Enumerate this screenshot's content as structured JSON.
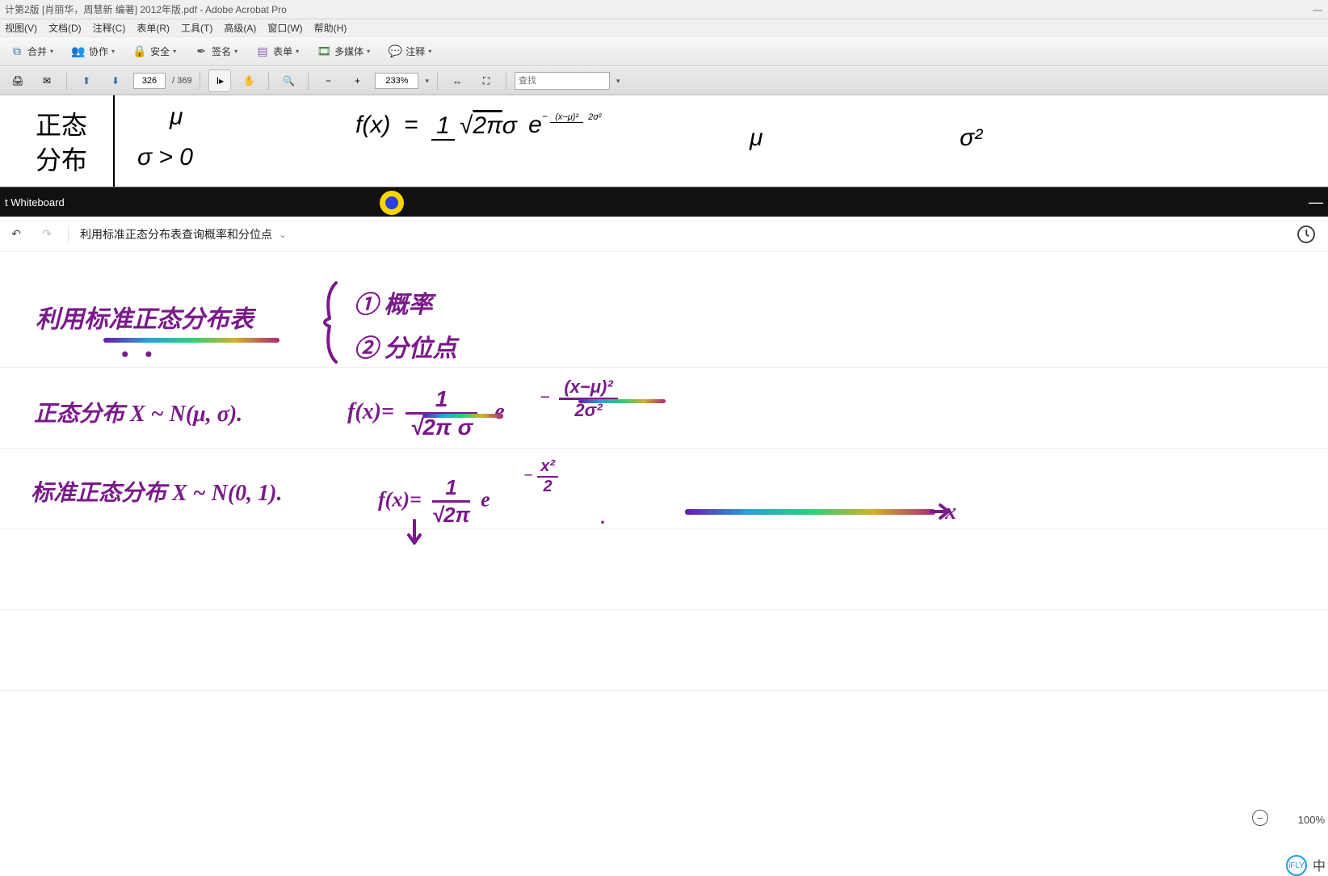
{
  "acrobat": {
    "title": "计第2版 [肖丽华，周慧新 编著] 2012年版.pdf - Adobe Acrobat Pro",
    "menu": {
      "view": "视图(V)",
      "doc": "文档(D)",
      "annot": "注释(C)",
      "forms": "表单(R)",
      "tools": "工具(T)",
      "adv": "高级(A)",
      "window": "窗口(W)",
      "help": "帮助(H)"
    },
    "toolbar1": {
      "merge": "合并",
      "collab": "协作",
      "secure": "安全",
      "sign": "签名",
      "form": "表单",
      "media": "多媒体",
      "comment": "注释"
    },
    "toolbar2": {
      "page": "326",
      "total": "/ 369",
      "zoom": "233%",
      "search_placeholder": "查找"
    }
  },
  "pdf": {
    "row_label_1": "正态",
    "row_label_2": "分布",
    "mu": "μ",
    "sigma_cond": "σ > 0",
    "fx_html": "f(x) = ",
    "col_mu": "μ",
    "col_sigma2": "σ²"
  },
  "whiteboard": {
    "app": "t Whiteboard",
    "board_title": "利用标准正态分布表查询概率和分位点"
  },
  "handwriting": {
    "h1": "利用标准正态分布表",
    "h1b1": "① 概率",
    "h1b2": "② 分位点",
    "h2a": "正态分布  X ~ N(μ, σ).",
    "h2b": "标准正态分布  X ~ N(0, 1).",
    "x_axis": "x"
  },
  "status": {
    "ime": "iFLY",
    "ime_cn": "中",
    "zoom": "100%"
  }
}
